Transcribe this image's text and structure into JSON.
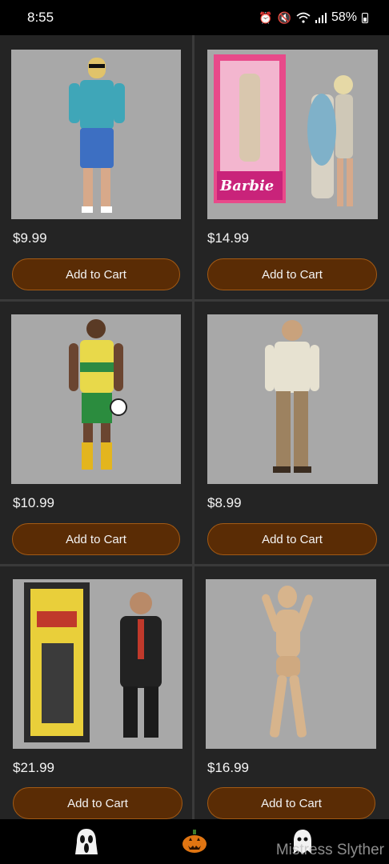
{
  "status": {
    "time": "8:55",
    "battery": "58%"
  },
  "products": [
    {
      "price": "$9.99",
      "button": "Add to Cart"
    },
    {
      "price": "$14.99",
      "button": "Add to Cart",
      "box_text": "Barbie"
    },
    {
      "price": "$10.99",
      "button": "Add to Cart"
    },
    {
      "price": "$8.99",
      "button": "Add to Cart"
    },
    {
      "price": "$21.99",
      "button": "Add to Cart"
    },
    {
      "price": "$16.99",
      "button": "Add to Cart"
    }
  ],
  "nav": {
    "items": [
      "scream-ghost-icon",
      "pumpkin-icon",
      "ghost-icon"
    ]
  },
  "watermark": "Mistress Slyther",
  "colors": {
    "accent_button": "#5a2c05",
    "button_border": "#a35a14",
    "image_bg": "#a8a8a8"
  }
}
